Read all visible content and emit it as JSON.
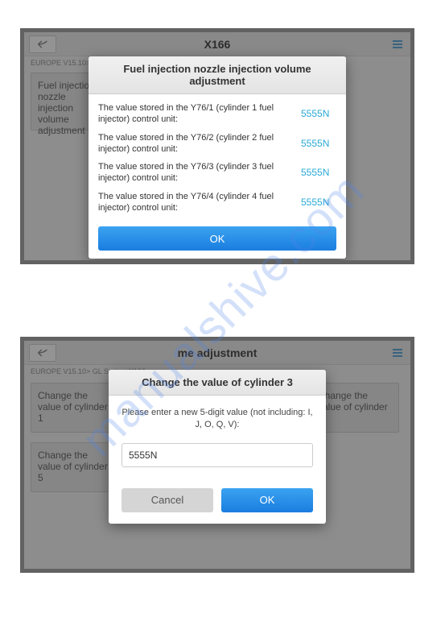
{
  "watermark": "manualshive.com",
  "screen1": {
    "topbar_title": "X166",
    "breadcrumb": "EUROPE V15.10> GL Series>X166",
    "bg_tile": "Fuel injection nozzle injection volume adjustment",
    "dialog": {
      "title": "Fuel injection nozzle injection volume adjustment",
      "rows": [
        {
          "label": "The value stored in the Y76/1 (cylinder 1 fuel injector) control unit:",
          "value": "5555N"
        },
        {
          "label": "The value stored in the Y76/2 (cylinder 2 fuel injector) control unit:",
          "value": "5555N"
        },
        {
          "label": "The value stored in the Y76/3 (cylinder 3 fuel injector) control unit:",
          "value": "5555N"
        },
        {
          "label": "The value stored in the Y76/4 (cylinder 4 fuel injector) control unit:",
          "value": "5555N"
        }
      ],
      "ok": "OK"
    }
  },
  "screen2": {
    "topbar_title": "me adjustment",
    "breadcrumb": "EUROPE V15.10> GL Series>X166",
    "tiles": [
      "Change the value of cylinder 1",
      "Change the value of cylinder 4",
      "Change the value of cylinder 5"
    ],
    "dialog": {
      "title": "Change the value of cylinder 3",
      "prompt": "Please enter a new 5-digit value (not including: I, J, O, Q, V):",
      "input_value": "5555N",
      "cancel": "Cancel",
      "ok": "OK"
    }
  }
}
